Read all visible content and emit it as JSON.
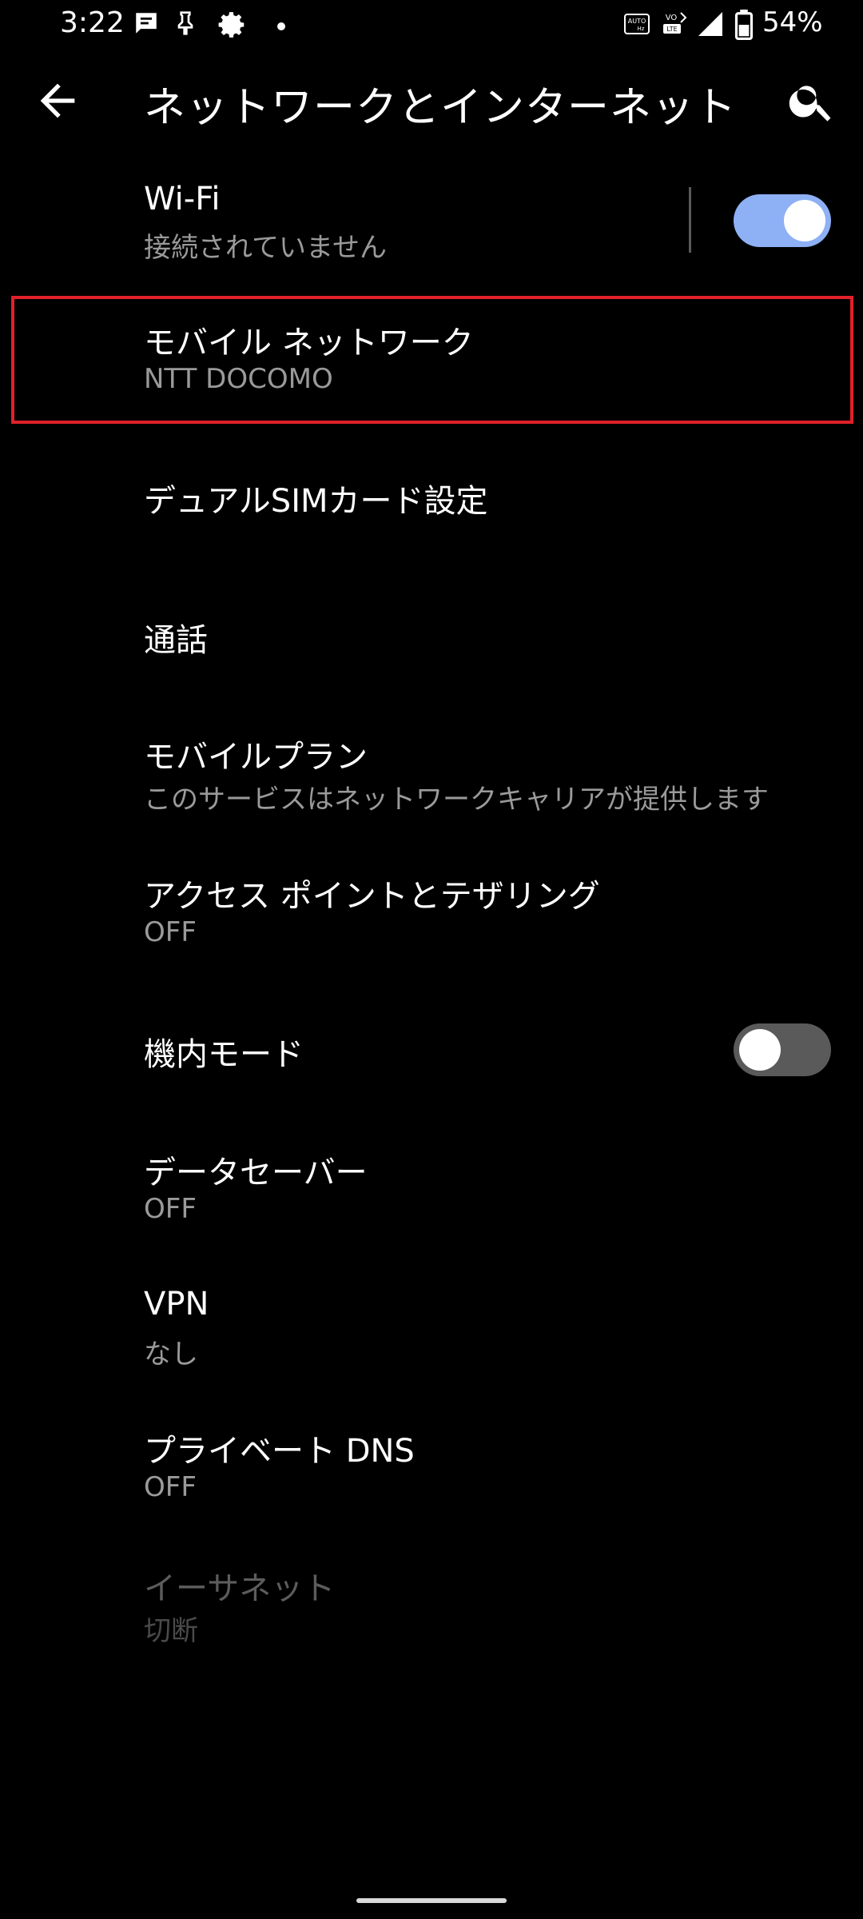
{
  "status_bar": {
    "time": "3:22",
    "battery_percent": "54%",
    "icons": [
      "message-icon",
      "pin-icon",
      "settings-gear-icon",
      "dot-icon",
      "auto-hz-icon",
      "volte-icon",
      "signal-icon",
      "battery-icon"
    ]
  },
  "app_bar": {
    "title": "ネットワークとインターネット",
    "back_icon": "arrow-back-icon",
    "search_icon": "search-icon"
  },
  "settings": {
    "wifi": {
      "title": "Wi-Fi",
      "summary": "接続されていません",
      "toggle_on": true
    },
    "mobile_network": {
      "title": "モバイル ネットワーク",
      "summary": "NTT DOCOMO"
    },
    "dual_sim": {
      "title": "デュアルSIMカード設定"
    },
    "calls": {
      "title": "通話"
    },
    "mobile_plan": {
      "title": "モバイルプラン",
      "summary": "このサービスはネットワークキャリアが提供します"
    },
    "hotspot": {
      "title": "アクセス ポイントとテザリング",
      "summary": "OFF"
    },
    "airplane": {
      "title": "機内モード",
      "toggle_on": false
    },
    "data_saver": {
      "title": "データセーバー",
      "summary": "OFF"
    },
    "vpn": {
      "title": "VPN",
      "summary": "なし"
    },
    "private_dns": {
      "title": "プライベート DNS",
      "summary": "OFF"
    },
    "ethernet": {
      "title": "イーサネット",
      "summary": "切断",
      "enabled": false
    }
  },
  "colors": {
    "background": "#000000",
    "switch_on_track": "#8eb0f5",
    "switch_off_track": "#5a5a5a",
    "highlight_border": "#e0202a"
  }
}
